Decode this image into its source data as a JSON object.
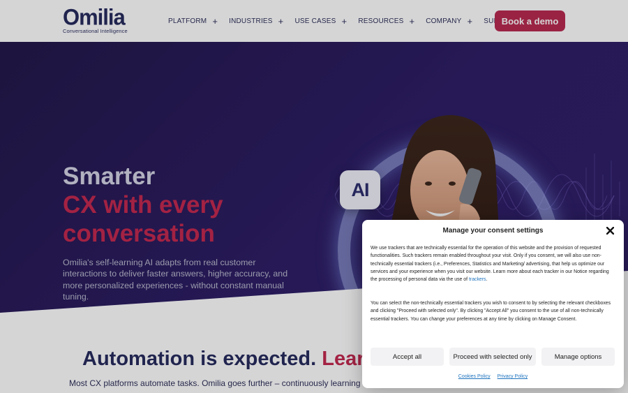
{
  "header": {
    "logo_text": "Omilia",
    "logo_tagline": "Conversational Intelligence",
    "nav": [
      {
        "label": "PLATFORM",
        "has_submenu": true
      },
      {
        "label": "INDUSTRIES",
        "has_submenu": true
      },
      {
        "label": "USE CASES",
        "has_submenu": true
      },
      {
        "label": "RESOURCES",
        "has_submenu": true
      },
      {
        "label": "COMPANY",
        "has_submenu": true
      },
      {
        "label": "SUPPORT",
        "has_submenu": false
      }
    ],
    "plus_glyph": "+",
    "cta_label": "Book a demo"
  },
  "hero": {
    "title_line1": "Smarter",
    "title_line2": "CX with every",
    "title_line3": "conversation",
    "subtitle": "Omilia's self-learning AI adapts from real customer interactions to deliver faster answers, higher accuracy, and more personalized experiences - without constant manual tuning.",
    "ai_badge_text": "AI",
    "icons": [
      "ai-badge-icon",
      "bot-icon",
      "phone-icon"
    ]
  },
  "section": {
    "title_main": "Automation is expected.",
    "title_accent": "Learni",
    "text": "Most CX platforms automate tasks. Omilia goes further – continuously learning from"
  },
  "consent": {
    "title": "Manage your consent settings",
    "paragraph1": "We use trackers that are technically essential for the operation of this website and the provision of requested functionalities. Such trackers remain enabled throughout your visit. Only if you consent, we will also use non-technically essential trackers (i.e., Preferences, Statistics and Marketing/ advertising, that help us optimize our services and your experience when you visit our website. Learn more about each tracker in our Notice regarding the processing of personal data via the use of",
    "paragraph1_link": "trackers",
    "paragraph1_end": ".",
    "paragraph2": "You can select the non-technically essential trackers you wish to consent to by selecting the relevant checkboxes and clicking \"Proceed with selected only\". By clicking \"Accept All\" you consent to the use of all non-technically essential trackers. You can change your preferences at any time by clicking on Manage Consent.",
    "buttons": {
      "accept_all": "Accept all",
      "proceed_selected": "Proceed with selected only",
      "manage_options": "Manage options"
    },
    "links": {
      "cookies_policy": "Cookies Policy",
      "privacy_policy": "Privacy Policy"
    }
  },
  "colors": {
    "brand_navy": "#23285a",
    "brand_crimson": "#c2254c",
    "cta": "#b8264c",
    "hero_bg": "#241758",
    "link": "#1e73be"
  }
}
